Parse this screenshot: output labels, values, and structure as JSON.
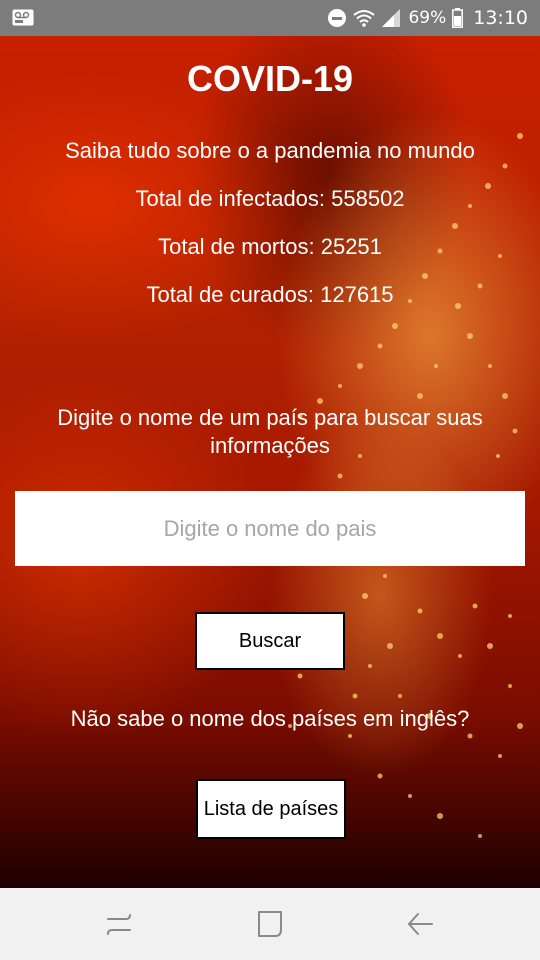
{
  "status_bar": {
    "battery_percent": "69%",
    "time": "13:10",
    "icons": [
      "voicemail-icon",
      "do-not-disturb-icon",
      "wifi-icon",
      "signal-icon",
      "battery-icon"
    ]
  },
  "main": {
    "title": "COVID-19",
    "subtitle": "Saiba tudo sobre o a pandemia no mundo",
    "infected": "Total de infectados: 558502",
    "deaths": "Total de mortos: 25251",
    "cured": "Total de curados: 127615",
    "prompt": "Digite o nome de um país para buscar suas informações",
    "search": {
      "placeholder": "Digite o nome do pais",
      "value": ""
    },
    "search_button_label": "Buscar",
    "question": "Não sabe o nome dos países em inglês?",
    "list_button_label": "Lista de países"
  },
  "nav_bar": {
    "icons": [
      "recent-apps-icon",
      "home-icon",
      "back-icon"
    ]
  },
  "colors": {
    "background_red": "#b52200",
    "status_bar": "#7c7c7c",
    "nav_bar": "#f1f1f1"
  }
}
